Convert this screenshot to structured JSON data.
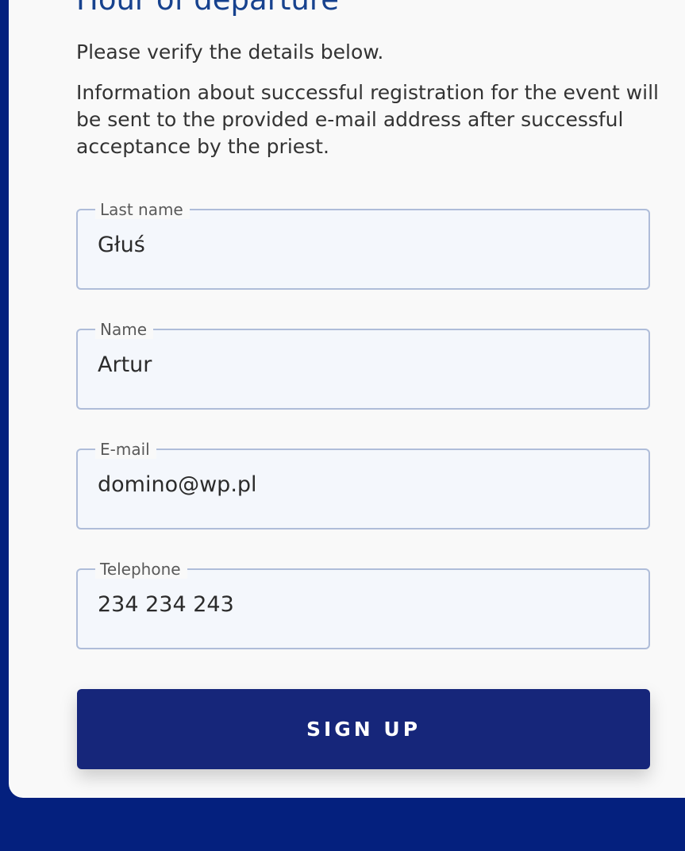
{
  "form": {
    "title": "Hour of departure",
    "verify_text": "Please verify the details below.",
    "info_text": "Information about successful registration for the event will be sent to the provided e-mail address after successful acceptance by the priest.",
    "fields": [
      {
        "label": "Last name",
        "value": "Głuś"
      },
      {
        "label": "Name",
        "value": "Artur"
      },
      {
        "label": "E-mail",
        "value": "domino@wp.pl"
      },
      {
        "label": "Telephone",
        "value": "234 234 243"
      }
    ],
    "submit_label": "SIGN UP"
  },
  "colors": {
    "background": "#04207e",
    "card": "#f9f9f9",
    "title": "#17428e",
    "field_border": "#afbdd9",
    "field_fill": "#f4f7fc",
    "button": "#16267a",
    "button_text": "#ffffff"
  }
}
